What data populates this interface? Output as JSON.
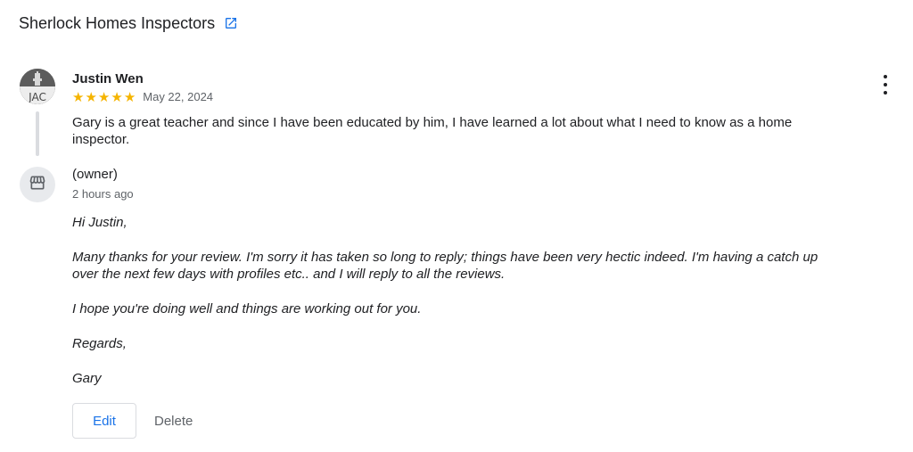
{
  "header": {
    "business_name": "Sherlock Homes Inspectors",
    "link_icon": "external-link-icon"
  },
  "review": {
    "reviewer_name": "Justin Wen",
    "avatar_text": "JAC",
    "rating": 5,
    "stars": [
      "★",
      "★",
      "★",
      "★",
      "★"
    ],
    "date": "May 22, 2024",
    "text": "Gary is a great teacher and since I have been educated by him, I have learned a lot about what I need to know as a home inspector.",
    "more_icon": "more-vert-icon"
  },
  "reply": {
    "owner_label": "(owner)",
    "owner_icon": "storefront-icon",
    "time": "2 hours ago",
    "paragraphs": [
      "Hi Justin,",
      "Many thanks for your review. I'm sorry it has taken so long to reply; things have been very hectic indeed. I'm having a catch up over the next few days with profiles etc.. and I will reply to all the reviews.",
      "I hope you're doing well and things are working out for you.",
      "Regards,",
      "Gary"
    ]
  },
  "actions": {
    "edit_label": "Edit",
    "delete_label": "Delete"
  },
  "colors": {
    "accent": "#1a73e8",
    "star": "#f5b400",
    "secondary_text": "#5f6368",
    "divider": "#dadce0"
  }
}
